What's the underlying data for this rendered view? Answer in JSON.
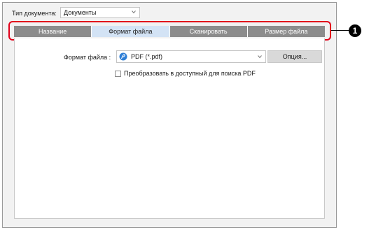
{
  "document_type": {
    "label": "Тип документа:",
    "value": "Документы"
  },
  "tabs": [
    {
      "label": "Название",
      "active": false
    },
    {
      "label": "Формат файла",
      "active": true
    },
    {
      "label": "Сканировать",
      "active": false
    },
    {
      "label": "Размер файла",
      "active": false
    }
  ],
  "file_format": {
    "label": "Формат файла  :",
    "value": "PDF (*.pdf)",
    "icon": "pdf-icon",
    "options_button": "Опция..."
  },
  "searchable_pdf": {
    "label": "Преобразовать в доступный для поиска PDF",
    "checked": false
  },
  "callout": {
    "number": "1"
  },
  "colors": {
    "tab_inactive": "#8c8c8c",
    "tab_active": "#d3e3f5",
    "highlight": "#e2001a"
  }
}
